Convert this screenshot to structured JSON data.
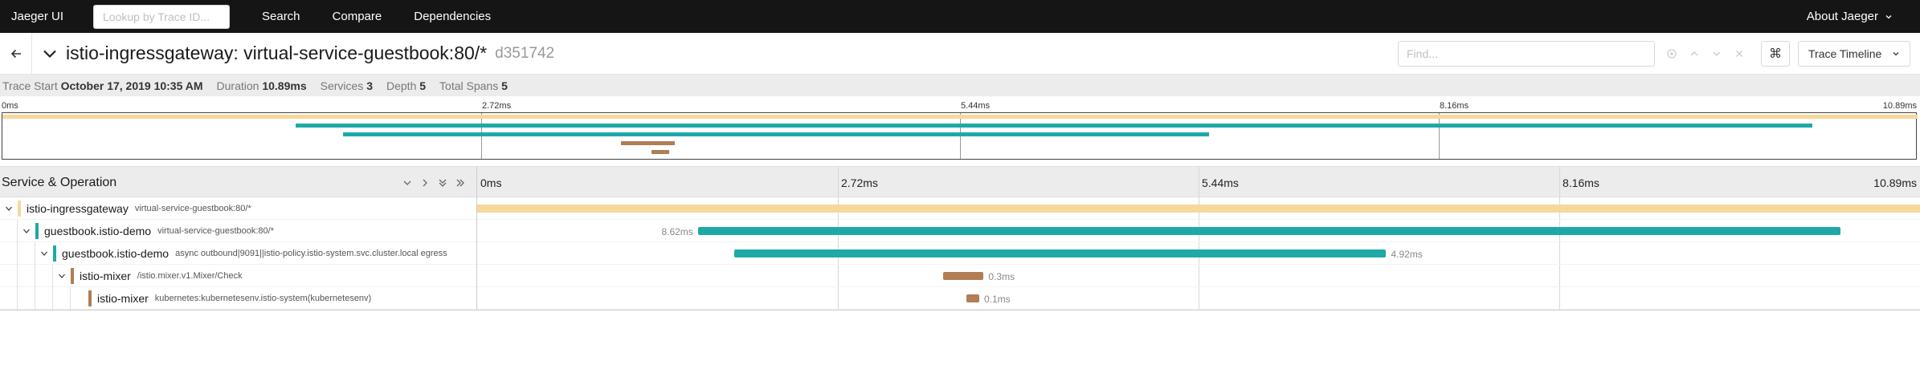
{
  "navbar": {
    "brand": "Jaeger UI",
    "search_placeholder": "Lookup by Trace ID...",
    "links": [
      "Search",
      "Compare",
      "Dependencies"
    ],
    "about": "About Jaeger"
  },
  "trace": {
    "title": "istio-ingressgateway: virtual-service-guestbook:80/*",
    "id": "d351742",
    "find_placeholder": "Find...",
    "view_mode": "Trace Timeline",
    "kbd_icon": "⌘"
  },
  "summary": {
    "trace_start_label": "Trace Start",
    "trace_start": "October 17, 2019 10:35 AM",
    "duration_label": "Duration",
    "duration": "10.89ms",
    "services_label": "Services",
    "services": "3",
    "depth_label": "Depth",
    "depth": "5",
    "total_spans_label": "Total Spans",
    "total_spans": "5"
  },
  "timeline": {
    "header_title": "Service & Operation",
    "ticks": [
      "0ms",
      "2.72ms",
      "5.44ms",
      "8.16ms",
      "10.89ms"
    ]
  },
  "colors": {
    "istio-ingressgateway": "#f7d79b",
    "guestbook.istio-demo": "#1fa8a8",
    "istio-mixer": "#b07d54"
  },
  "spans": [
    {
      "service": "istio-ingressgateway",
      "operation": "virtual-service-guestbook:80/*",
      "depth": 0,
      "start": 0.0,
      "end": 1.0,
      "duration_label": "",
      "label_side": "none",
      "has_children": true
    },
    {
      "service": "guestbook.istio-demo",
      "operation": "virtual-service-guestbook:80/*",
      "depth": 1,
      "start": 0.153,
      "end": 0.945,
      "duration_label": "8.62ms",
      "label_side": "left",
      "has_children": true
    },
    {
      "service": "guestbook.istio-demo",
      "operation": "async outbound|9091||istio-policy.istio-system.svc.cluster.local egress",
      "depth": 2,
      "start": 0.178,
      "end": 0.63,
      "duration_label": "4.92ms",
      "label_side": "right",
      "has_children": true
    },
    {
      "service": "istio-mixer",
      "operation": "/istio.mixer.v1.Mixer/Check",
      "depth": 3,
      "start": 0.323,
      "end": 0.351,
      "duration_label": "0.3ms",
      "label_side": "right",
      "has_children": true
    },
    {
      "service": "istio-mixer",
      "operation": "kubernetes:kubernetesenv.istio-system(kubernetesenv)",
      "depth": 4,
      "start": 0.339,
      "end": 0.348,
      "duration_label": "0.1ms",
      "label_side": "right",
      "has_children": false
    }
  ]
}
